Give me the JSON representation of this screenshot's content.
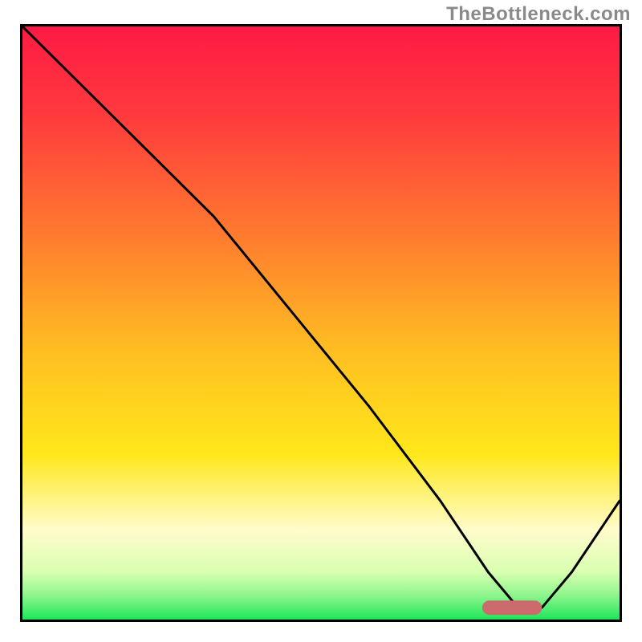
{
  "watermark": "TheBottleneck.com",
  "colors": {
    "frame_border": "#000000",
    "line": "#000000",
    "marker_fill": "#cd6a6d",
    "marker_stroke": "#cd6a6d",
    "gradient_stops": [
      {
        "offset": 0.0,
        "color": "#ff1a44"
      },
      {
        "offset": 0.15,
        "color": "#ff3a3d"
      },
      {
        "offset": 0.35,
        "color": "#ff7a2f"
      },
      {
        "offset": 0.55,
        "color": "#ffbf22"
      },
      {
        "offset": 0.72,
        "color": "#ffe71a"
      },
      {
        "offset": 0.85,
        "color": "#fffccc"
      },
      {
        "offset": 0.92,
        "color": "#d9ffb0"
      },
      {
        "offset": 0.96,
        "color": "#8cf58c"
      },
      {
        "offset": 1.0,
        "color": "#1ee65a"
      }
    ]
  },
  "chart_data": {
    "type": "line",
    "title": "",
    "xlabel": "",
    "ylabel": "",
    "xlim": [
      0,
      100
    ],
    "ylim": [
      0,
      100
    ],
    "series": [
      {
        "name": "bottleneck_curve",
        "x": [
          0,
          10,
          22,
          32,
          45,
          58,
          70,
          78,
          83,
          87,
          92,
          100
        ],
        "y": [
          100,
          90,
          78,
          68,
          52,
          36,
          20,
          8,
          2,
          2,
          8,
          20
        ]
      }
    ],
    "optimal_marker": {
      "x": 82,
      "y": 2,
      "width": 9,
      "height": 1.4
    }
  }
}
